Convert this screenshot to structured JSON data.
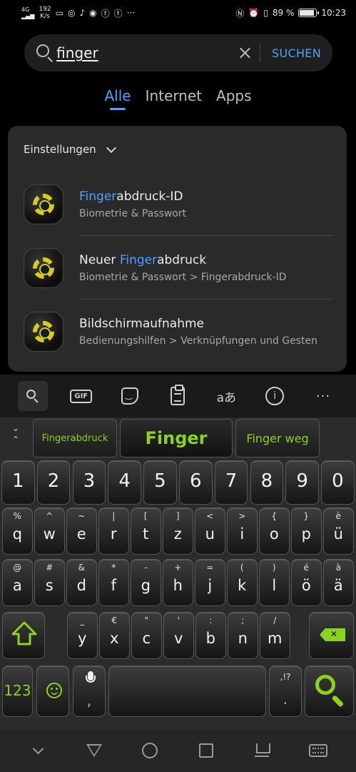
{
  "status_bar": {
    "network": "4G",
    "speed_value": "192",
    "speed_unit": "K/s",
    "left_icons": [
      "sim-icon",
      "instagram-icon",
      "bell-icon",
      "chrome-icon",
      "facebook-icon",
      "facebook-icon",
      "more-dots-icon"
    ],
    "battery_percent": "89 %",
    "battery_level": 0.89,
    "time": "10:23"
  },
  "search": {
    "query": "finger",
    "submit_label": "SUCHEN"
  },
  "tabs": [
    {
      "label": "Alle",
      "active": true
    },
    {
      "label": "Internet",
      "active": false
    },
    {
      "label": "Apps",
      "active": false
    }
  ],
  "results": {
    "section_title": "Einstellungen",
    "items": [
      {
        "title_highlight": "Finger",
        "title_rest": "abdruck-ID",
        "subtitle": "Biometrie & Passwort"
      },
      {
        "title_prefix": "Neuer ",
        "title_highlight": "Finger",
        "title_rest": "abdruck",
        "subtitle": "Biometrie & Passwort > Fingerabdruck-ID"
      },
      {
        "title": "Bildschirmaufnahme",
        "subtitle": "Bedienungshilfen > Verknüpfungen und Gesten"
      }
    ]
  },
  "keyboard": {
    "toolbar": {
      "gif_label": "GIF",
      "translate_glyph": "あ",
      "info_glyph": "i",
      "more_glyph": "···"
    },
    "suggestions": [
      "Fingerabdruck",
      "Finger",
      "Finger weg"
    ],
    "number_row": [
      "1",
      "2",
      "3",
      "4",
      "5",
      "6",
      "7",
      "8",
      "9",
      "0"
    ],
    "row1": [
      {
        "main": "q",
        "alt": "%"
      },
      {
        "main": "w",
        "alt": "^"
      },
      {
        "main": "e",
        "alt": "~"
      },
      {
        "main": "r",
        "alt": "|"
      },
      {
        "main": "t",
        "alt": "["
      },
      {
        "main": "z",
        "alt": "]"
      },
      {
        "main": "u",
        "alt": "<"
      },
      {
        "main": "i",
        "alt": ">"
      },
      {
        "main": "o",
        "alt": "{"
      },
      {
        "main": "p",
        "alt": "}"
      },
      {
        "main": "ü",
        "alt": "è"
      }
    ],
    "row2": [
      {
        "main": "a",
        "alt": "@"
      },
      {
        "main": "s",
        "alt": "#"
      },
      {
        "main": "d",
        "alt": "&"
      },
      {
        "main": "f",
        "alt": "*"
      },
      {
        "main": "g",
        "alt": "-"
      },
      {
        "main": "h",
        "alt": "+"
      },
      {
        "main": "j",
        "alt": "="
      },
      {
        "main": "k",
        "alt": "("
      },
      {
        "main": "l",
        "alt": ")"
      },
      {
        "main": "ö",
        "alt": "é"
      },
      {
        "main": "ä",
        "alt": "à"
      }
    ],
    "row3": [
      {
        "main": "y",
        "alt": "_"
      },
      {
        "main": "x",
        "alt": "€"
      },
      {
        "main": "c",
        "alt": "\""
      },
      {
        "main": "v",
        "alt": "'"
      },
      {
        "main": "b",
        "alt": ":"
      },
      {
        "main": "n",
        "alt": ";"
      },
      {
        "main": "m",
        "alt": "/"
      }
    ],
    "bottom": {
      "numbers_label": "123",
      "comma": ",",
      "period": ".",
      "period_alt": ",!?"
    }
  },
  "colors": {
    "accent_blue": "#4aa3ff",
    "keyboard_green": "#8bd31c",
    "icon_yellow": "#d6cc20"
  }
}
